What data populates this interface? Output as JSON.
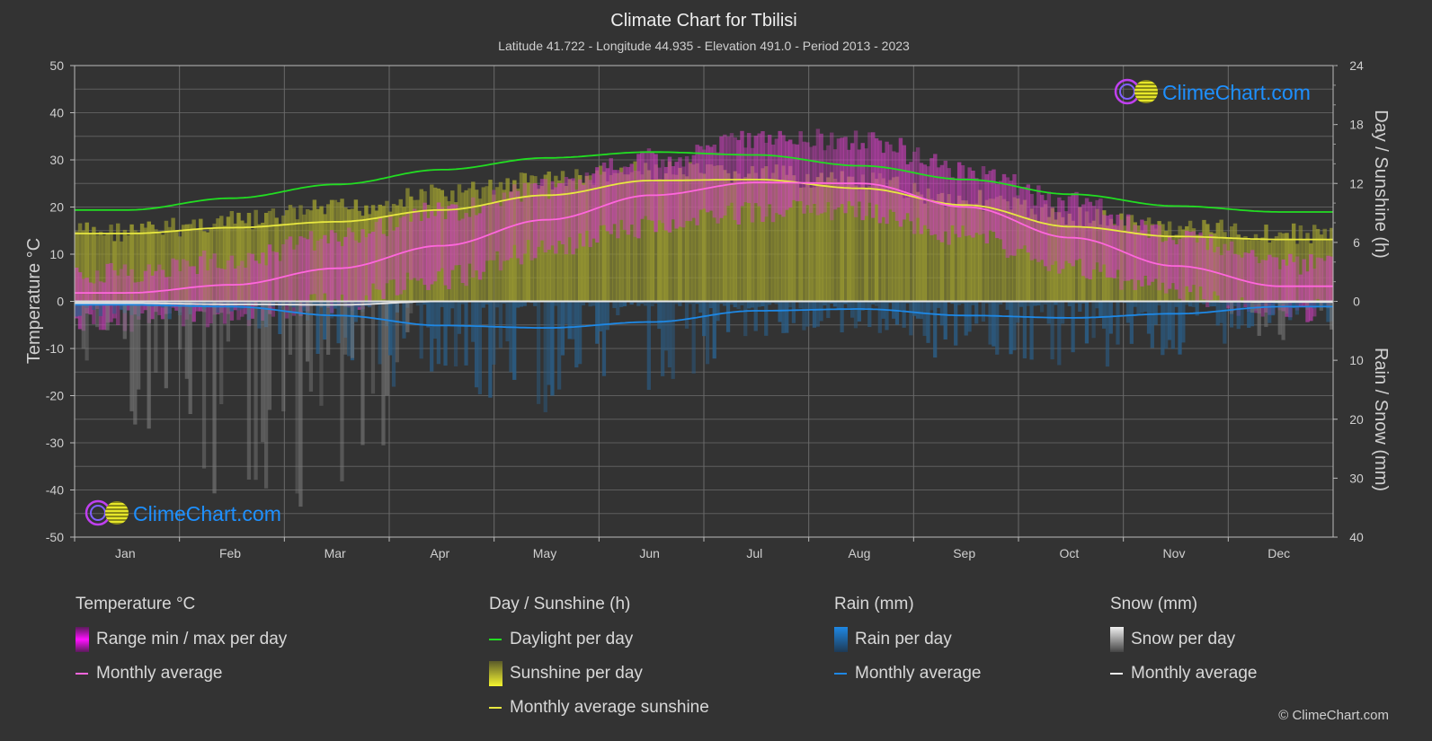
{
  "header": {
    "title": "Climate Chart for Tbilisi",
    "subtitle": "Latitude 41.722 - Longitude 44.935 - Elevation 491.0 - Period 2013 - 2023"
  },
  "colors": {
    "background": "#333333",
    "grid": "#5e5e5e",
    "temp_range": "#e020e0",
    "temp_avg": "#ff66dd",
    "daylight": "#22dd22",
    "sunshine_fill": "#9a9a30",
    "sunshine_avg": "#e8e840",
    "rain": "#1e88e5",
    "rain_fill": "#2a5f8a",
    "snow": "#e6e6e6",
    "snow_fill": "#7a7a7a",
    "brand": "#1e90ff"
  },
  "logo": {
    "text": "ClimeChart.com"
  },
  "copyright": "© ClimeChart.com",
  "chart_data": {
    "type": "area",
    "title": "Climate Chart for Tbilisi",
    "categories": [
      "Jan",
      "Feb",
      "Mar",
      "Apr",
      "May",
      "Jun",
      "Jul",
      "Aug",
      "Sep",
      "Oct",
      "Nov",
      "Dec"
    ],
    "left_axis": {
      "label": "Temperature °C",
      "range": [
        -50,
        50
      ],
      "ticks": [
        "50",
        "40",
        "30",
        "20",
        "10",
        "0",
        "-10",
        "-20",
        "-30",
        "-40",
        "-50"
      ]
    },
    "right_axis_top": {
      "label": "Day / Sunshine (h)",
      "range": [
        0,
        24
      ],
      "ticks": [
        "24",
        "18",
        "12",
        "6",
        "0"
      ]
    },
    "right_axis_bottom": {
      "label": "Rain / Snow (mm)",
      "range": [
        0,
        40
      ],
      "ticks": [
        "10",
        "20",
        "30",
        "40"
      ]
    },
    "grid": true,
    "series": [
      {
        "name": "Temperature monthly average",
        "unit": "°C",
        "axis": "left",
        "values": [
          1.8,
          3.5,
          7.0,
          11.8,
          17.3,
          22.5,
          25.2,
          25.0,
          20.0,
          13.5,
          7.5,
          3.2
        ]
      },
      {
        "name": "Temperature range max (approx.)",
        "unit": "°C",
        "axis": "left",
        "values": [
          6,
          9,
          13,
          19,
          24,
          30,
          35,
          34,
          28,
          21,
          14,
          8
        ]
      },
      {
        "name": "Temperature range min (approx.)",
        "unit": "°C",
        "axis": "left",
        "values": [
          -4,
          -3,
          0,
          5,
          11,
          16,
          19,
          19,
          14,
          7,
          2,
          -2
        ]
      },
      {
        "name": "Daylight per day",
        "unit": "h",
        "axis": "right_top",
        "values": [
          9.3,
          10.5,
          11.9,
          13.4,
          14.6,
          15.2,
          14.9,
          13.8,
          12.4,
          10.9,
          9.7,
          9.1
        ]
      },
      {
        "name": "Sunshine per day (upper envelope)",
        "unit": "h",
        "axis": "right_top",
        "values": [
          8.2,
          9.2,
          10.5,
          12.0,
          13.5,
          14.3,
          14.0,
          13.2,
          11.5,
          9.8,
          8.6,
          8.0
        ]
      },
      {
        "name": "Monthly average sunshine",
        "unit": "h",
        "axis": "right_top",
        "values": [
          6.9,
          7.5,
          8.1,
          9.3,
          10.8,
          12.3,
          12.4,
          11.5,
          9.8,
          7.6,
          6.6,
          6.3
        ]
      },
      {
        "name": "Rain monthly average",
        "unit": "mm",
        "axis": "right_bottom",
        "values": [
          0.6,
          0.9,
          2.4,
          4.1,
          4.5,
          3.5,
          1.6,
          1.3,
          2.4,
          2.8,
          2.1,
          0.9
        ]
      },
      {
        "name": "Snow monthly average",
        "unit": "mm",
        "axis": "right_bottom",
        "values": [
          0.3,
          0.5,
          0.6,
          0.0,
          0.0,
          0.0,
          0.0,
          0.0,
          0.0,
          0.0,
          0.0,
          0.1
        ]
      }
    ]
  },
  "legend": {
    "groups": [
      {
        "title": "Temperature °C",
        "items": [
          {
            "label": "Range min / max per day",
            "kind": "bar",
            "color_key": "temp_range"
          },
          {
            "label": "Monthly average",
            "kind": "line",
            "color_key": "temp_avg"
          }
        ]
      },
      {
        "title": "Day / Sunshine (h)",
        "items": [
          {
            "label": "Daylight per day",
            "kind": "line",
            "color_key": "daylight"
          },
          {
            "label": "Sunshine per day",
            "kind": "bar",
            "color_key": "sunshine_avg"
          },
          {
            "label": "Monthly average sunshine",
            "kind": "line",
            "color_key": "sunshine_avg"
          }
        ]
      },
      {
        "title": "Rain (mm)",
        "items": [
          {
            "label": "Rain per day",
            "kind": "bar",
            "color_key": "rain"
          },
          {
            "label": "Monthly average",
            "kind": "line",
            "color_key": "rain"
          }
        ]
      },
      {
        "title": "Snow (mm)",
        "items": [
          {
            "label": "Snow per day",
            "kind": "bar",
            "color_key": "snow"
          },
          {
            "label": "Monthly average",
            "kind": "line",
            "color_key": "snow"
          }
        ]
      }
    ]
  }
}
